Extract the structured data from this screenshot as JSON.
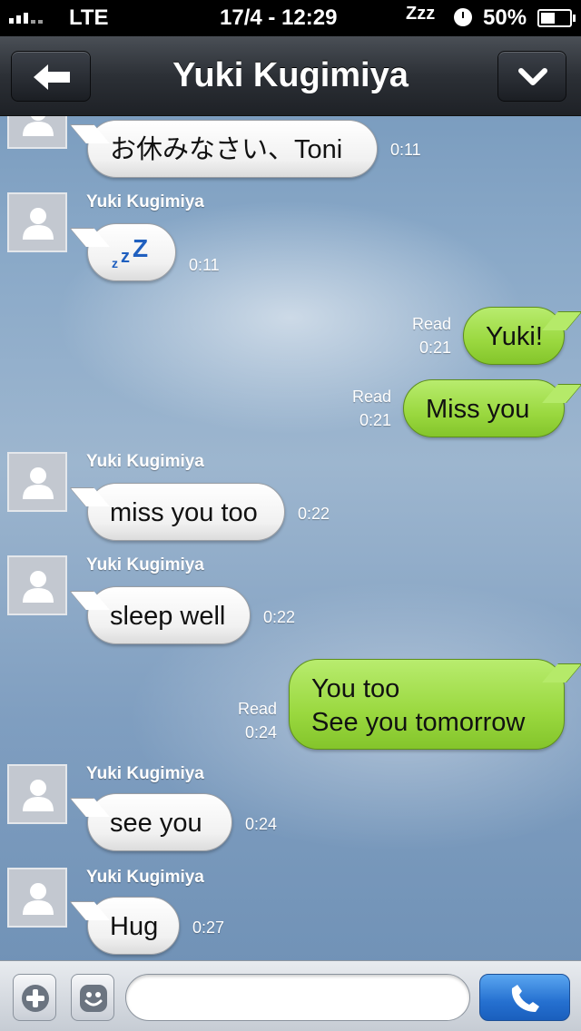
{
  "status_bar": {
    "network": "LTE",
    "datetime": "17/4 - 12:29",
    "dnd_glyph": "Zzz",
    "battery": "50%",
    "battery_level": 0.5
  },
  "header": {
    "title": "Yuki Kugimiya",
    "back_icon": "back-arrow-icon",
    "menu_icon": "chevron-down-icon"
  },
  "messages": [
    {
      "direction": "in",
      "sender": "",
      "text": "お休みなさい、Toni",
      "time": "0:11"
    },
    {
      "direction": "in",
      "sender": "Yuki Kugimiya",
      "text": "zzZ",
      "sticker": "sleeping-zzz-icon",
      "time": "0:11"
    },
    {
      "direction": "out",
      "text": "Yuki!",
      "read": "Read",
      "time": "0:21"
    },
    {
      "direction": "out",
      "text": "Miss you",
      "read": "Read",
      "time": "0:21"
    },
    {
      "direction": "in",
      "sender": "Yuki Kugimiya",
      "text": "miss you too",
      "time": "0:22"
    },
    {
      "direction": "in",
      "sender": "Yuki Kugimiya",
      "text": "sleep well",
      "time": "0:22"
    },
    {
      "direction": "out",
      "lines": [
        "You too",
        "See you tomorrow"
      ],
      "read": "Read",
      "time": "0:24"
    },
    {
      "direction": "in",
      "sender": "Yuki Kugimiya",
      "text": "see you",
      "time": "0:24"
    },
    {
      "direction": "in",
      "sender": "Yuki Kugimiya",
      "text": "Hug",
      "time": "0:27"
    }
  ],
  "composer": {
    "placeholder": "",
    "add_icon": "plus-icon",
    "emoji_icon": "smiley-icon",
    "call_icon": "phone-icon"
  },
  "colors": {
    "incoming_bubble": "#ffffff",
    "outgoing_bubble": "#9ad83f",
    "navbar": "#2c3036",
    "call_button": "#2570d0"
  }
}
